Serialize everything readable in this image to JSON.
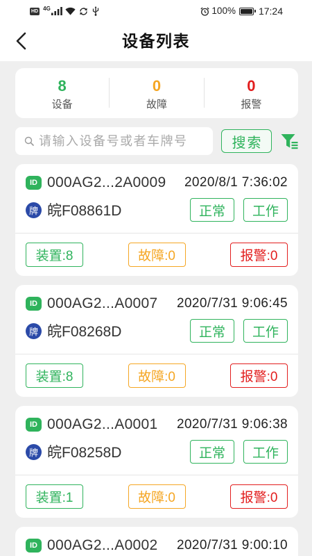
{
  "status_bar": {
    "hd_label": "HD",
    "network_label": "4G",
    "battery_text": "100%",
    "time": "17:24",
    "left_icons": [
      "hd-icon",
      "signal-icon",
      "wifi-icon",
      "sync-icon",
      "usb-icon"
    ],
    "right_icons": [
      "alarm-icon",
      "battery-icon"
    ]
  },
  "header": {
    "back_icon": "chevron-left-icon",
    "title": "设备列表"
  },
  "summary": {
    "devices": {
      "value": "8",
      "label": "设备"
    },
    "faults": {
      "value": "0",
      "label": "故障"
    },
    "alarms": {
      "value": "0",
      "label": "报警"
    }
  },
  "search": {
    "icon": "search-icon",
    "placeholder": "请输入设备号或者车牌号",
    "value": "",
    "button_label": "搜索",
    "filter_icon": "filter-icon"
  },
  "colors": {
    "primary_green": "#2fb35c",
    "warning_orange": "#f5a623",
    "alarm_red": "#e21d1d",
    "plate_badge_blue": "#2b4aa8",
    "background": "#efefef",
    "card": "#ffffff",
    "text": "#333333"
  },
  "device_list": [
    {
      "id_badge": "ID",
      "device_id": "000AG2...2A0009",
      "timestamp": "2020/8/1 7:36:02",
      "plate_badge": "牌",
      "plate_number": "皖F08861D",
      "status": "正常",
      "work_state": "工作",
      "units": "装置:8",
      "faults": "故障:0",
      "alarms": "报警:0"
    },
    {
      "id_badge": "ID",
      "device_id": "000AG2...A0007",
      "timestamp": "2020/7/31 9:06:45",
      "plate_badge": "牌",
      "plate_number": "皖F08268D",
      "status": "正常",
      "work_state": "工作",
      "units": "装置:8",
      "faults": "故障:0",
      "alarms": "报警:0"
    },
    {
      "id_badge": "ID",
      "device_id": "000AG2...A0001",
      "timestamp": "2020/7/31 9:06:38",
      "plate_badge": "牌",
      "plate_number": "皖F08258D",
      "status": "正常",
      "work_state": "工作",
      "units": "装置:1",
      "faults": "故障:0",
      "alarms": "报警:0"
    },
    {
      "id_badge": "ID",
      "device_id": "000AG2...A0002",
      "timestamp": "2020/7/31 9:00:10"
    }
  ]
}
